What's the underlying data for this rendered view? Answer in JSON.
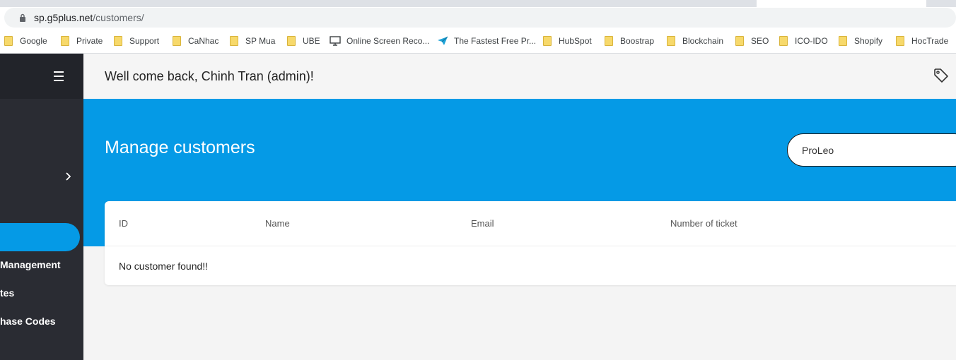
{
  "browser": {
    "url_host": "sp.g5plus.net",
    "url_path": "/customers/",
    "bookmarks": [
      {
        "label": "Google",
        "icon": "folder-icon"
      },
      {
        "label": "Private",
        "icon": "folder-icon"
      },
      {
        "label": "Support",
        "icon": "folder-icon"
      },
      {
        "label": "CaNhac",
        "icon": "folder-icon"
      },
      {
        "label": "SP Mua",
        "icon": "folder-icon"
      },
      {
        "label": "UBE",
        "icon": "folder-icon"
      },
      {
        "label": "Online Screen Reco...",
        "icon": "monitor-icon"
      },
      {
        "label": "The Fastest Free Pr...",
        "icon": "paper-plane-icon"
      },
      {
        "label": "HubSpot",
        "icon": "folder-icon"
      },
      {
        "label": "Boostrap",
        "icon": "folder-icon"
      },
      {
        "label": "Blockchain",
        "icon": "folder-icon"
      },
      {
        "label": "SEO",
        "icon": "folder-icon"
      },
      {
        "label": "ICO-IDO",
        "icon": "folder-icon"
      },
      {
        "label": "Shopify",
        "icon": "folder-icon"
      },
      {
        "label": "HocTrade",
        "icon": "folder-icon"
      }
    ]
  },
  "sidebar": {
    "items": [
      {
        "label": "Management"
      },
      {
        "label": "tes"
      },
      {
        "label": "hase Codes"
      }
    ]
  },
  "topbar": {
    "welcome": "Well come back, Chinh Tran (admin)!"
  },
  "hero": {
    "title": "Manage customers",
    "search_value": "ProLeo"
  },
  "table": {
    "columns": [
      "ID",
      "Name",
      "Email",
      "Number of ticket"
    ],
    "empty_message": "No customer found!!"
  },
  "colors": {
    "accent": "#059ae6",
    "sidebar": "#2a2c33"
  }
}
